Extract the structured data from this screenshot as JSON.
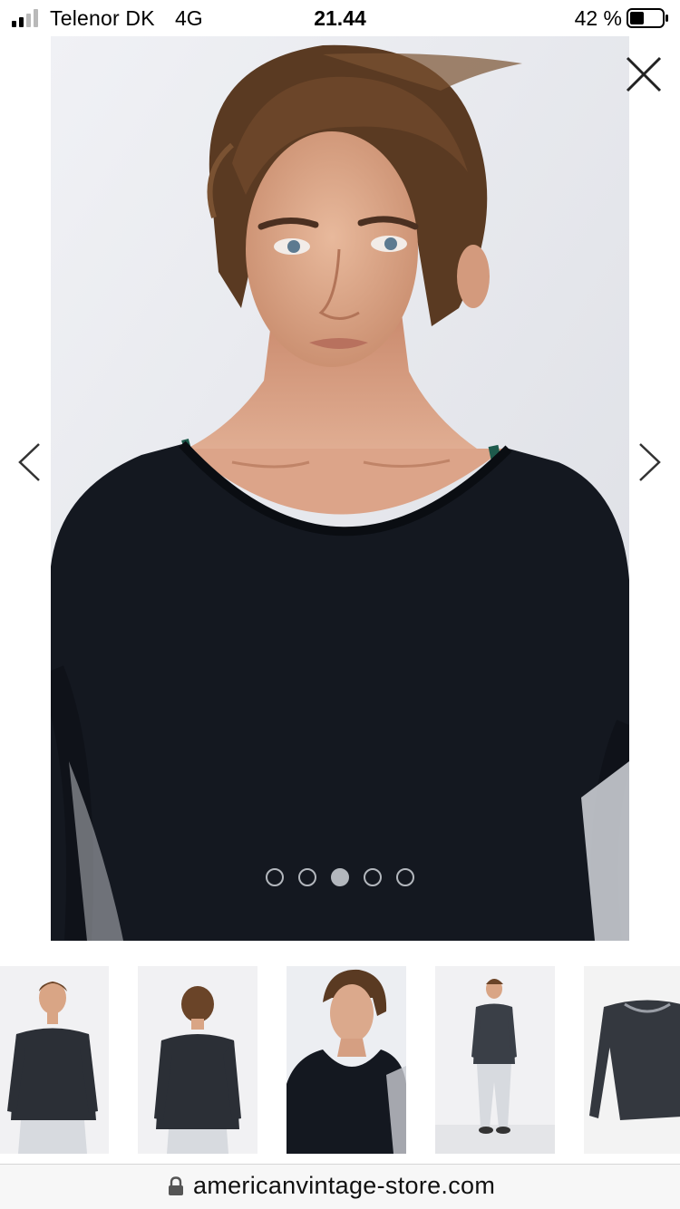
{
  "status_bar": {
    "carrier": "Telenor DK",
    "network": "4G",
    "time": "21.44",
    "battery_percent": "42 %",
    "signal_bars_filled": 2,
    "signal_bars_total": 4,
    "battery_level": 0.42
  },
  "gallery": {
    "slide_count": 5,
    "active_slide": 3,
    "close_icon": "close-icon",
    "prev_icon": "chevron-left-icon",
    "next_icon": "chevron-right-icon"
  },
  "thumbnails": [
    {
      "view": "front-full",
      "selected": false
    },
    {
      "view": "back",
      "selected": false
    },
    {
      "view": "closeup",
      "selected": true
    },
    {
      "view": "full-body",
      "selected": false
    },
    {
      "view": "flat-product",
      "selected": false
    }
  ],
  "address_bar": {
    "url": "americanvintage-store.com",
    "lock_icon": "lock-icon"
  },
  "colors": {
    "garment": "#141820",
    "dot": "#b3b7bd",
    "background": "#eceef2"
  }
}
